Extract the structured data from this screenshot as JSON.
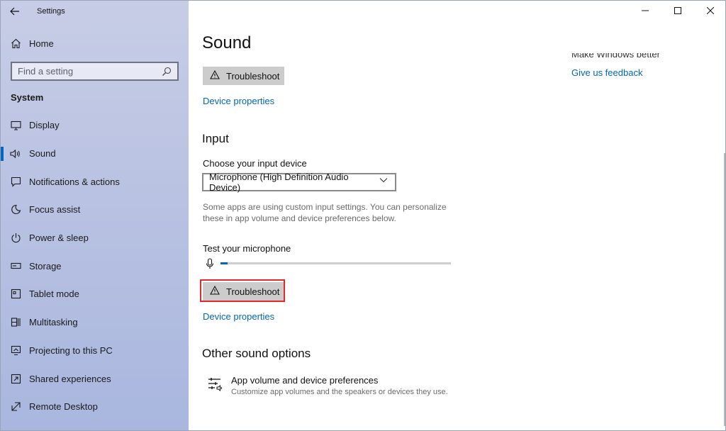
{
  "window": {
    "app_title": "Settings"
  },
  "caption": {
    "minimize": "—",
    "maximize": "☐",
    "close": "✕"
  },
  "sidebar": {
    "home": "Home",
    "search_placeholder": "Find a setting",
    "section": "System",
    "items": [
      {
        "label": "Display",
        "icon": "display-icon",
        "active": false
      },
      {
        "label": "Sound",
        "icon": "speaker-icon",
        "active": true
      },
      {
        "label": "Notifications & actions",
        "icon": "notifications-icon",
        "active": false
      },
      {
        "label": "Focus assist",
        "icon": "moon-icon",
        "active": false
      },
      {
        "label": "Power & sleep",
        "icon": "power-icon",
        "active": false
      },
      {
        "label": "Storage",
        "icon": "storage-icon",
        "active": false
      },
      {
        "label": "Tablet mode",
        "icon": "tablet-icon",
        "active": false
      },
      {
        "label": "Multitasking",
        "icon": "multitasking-icon",
        "active": false
      },
      {
        "label": "Projecting to this PC",
        "icon": "projecting-icon",
        "active": false
      },
      {
        "label": "Shared experiences",
        "icon": "shared-icon",
        "active": false
      },
      {
        "label": "Remote Desktop",
        "icon": "remote-desktop-icon",
        "active": false
      }
    ]
  },
  "main": {
    "title": "Sound",
    "output_troubleshoot": "Troubleshoot",
    "output_device_properties": "Device properties",
    "input_heading": "Input",
    "choose_input_label": "Choose your input device",
    "input_device": "Microphone (High Definition Audio Device)",
    "custom_settings_hint": "Some apps are using custom input settings. You can personalize these in app volume and device preferences below.",
    "test_mic_label": "Test your microphone",
    "mic_level": 0.03,
    "input_troubleshoot": "Troubleshoot",
    "input_device_properties": "Device properties",
    "other_heading": "Other sound options",
    "app_volume_title": "App volume and device preferences",
    "app_volume_desc": "Customize app volumes and the speakers or devices they use."
  },
  "right_column": {
    "cut_heading": "Make Windows better",
    "feedback_link": "Give us feedback"
  },
  "colors": {
    "accent": "#0067c0",
    "link": "#0067b8",
    "highlight": "#e3282c"
  }
}
